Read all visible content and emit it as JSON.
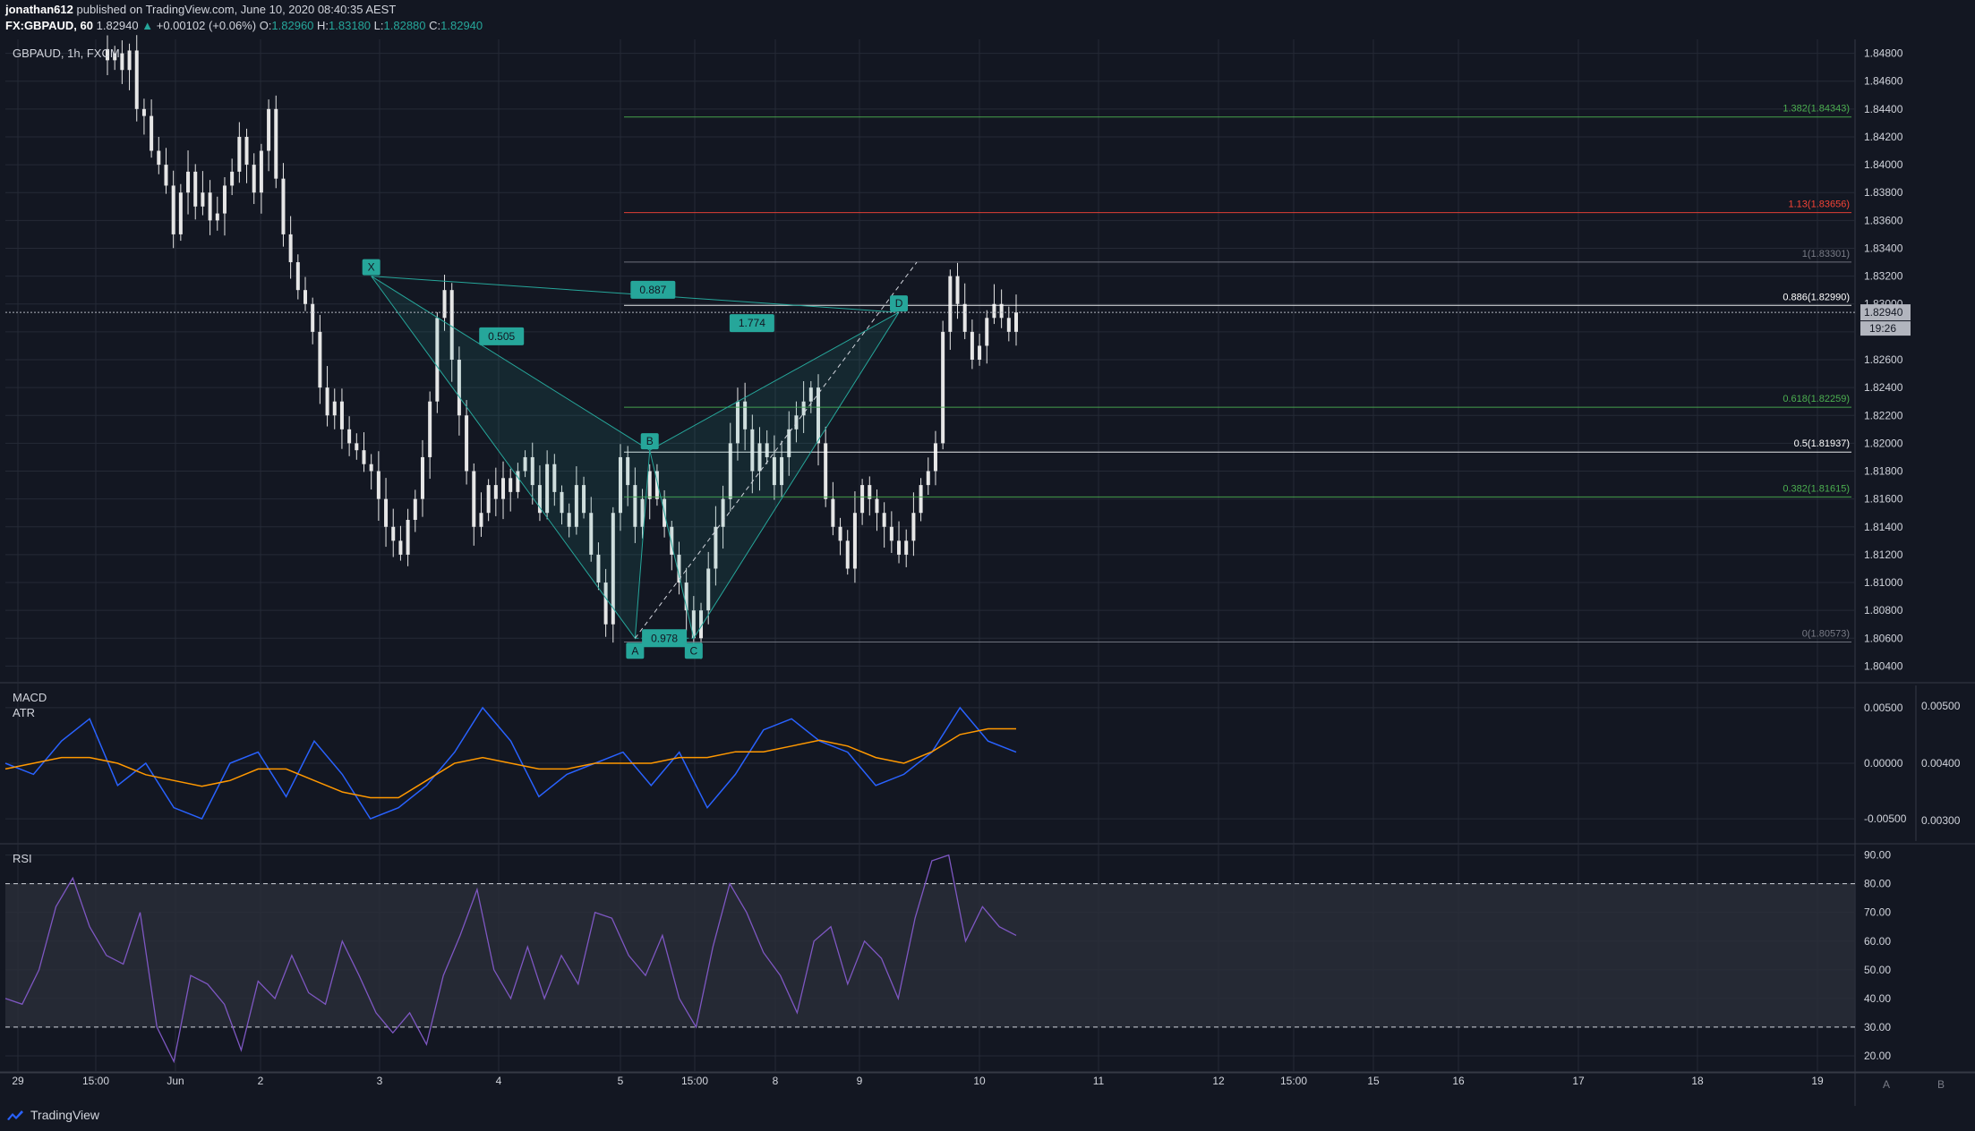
{
  "header": {
    "author": "jonathan612",
    "published": "published on TradingView.com, June 10, 2020 08:40:35 AEST",
    "symbol": "FX:GBPAUD, 60",
    "last": "1.82940",
    "change_arrow": "▲",
    "change": "+0.00102 (+0.06%)",
    "o_label": "O:",
    "o": "1.82960",
    "h_label": "H:",
    "h": "1.83180",
    "l_label": "L:",
    "l": "1.82880",
    "c_label": "C:",
    "c": "1.82940"
  },
  "footer": {
    "brand": "TradingView",
    "logo_icon": "tradingview-logo-icon"
  },
  "colors": {
    "background": "#131722",
    "grid": "#252a36",
    "text": "#d1d4dc",
    "candle": "#e6e6e6",
    "pattern": "#26a69a",
    "macd": "#2962ff",
    "atr": "#ff9800",
    "rsi": "#7e57c2",
    "fib_green": "#4caf50",
    "fib_red": "#f44336",
    "fib_grey": "#787b86",
    "fib_white": "#ffffff"
  },
  "chart_data": [
    {
      "type": "candlestick",
      "title": "GBPAUD, 1h, FXCM",
      "ylim": [
        1.803,
        1.849
      ],
      "y_ticks": [
        "1.84800",
        "1.84600",
        "1.84400",
        "1.84200",
        "1.84000",
        "1.83800",
        "1.83600",
        "1.83400",
        "1.83200",
        "1.83000",
        "1.82800",
        "1.82600",
        "1.82400",
        "1.82200",
        "1.82000",
        "1.81800",
        "1.81600",
        "1.81400",
        "1.81200",
        "1.81000",
        "1.80800",
        "1.80600",
        "1.80400"
      ],
      "x_ticks": [
        "29",
        "15:00",
        "Jun",
        "2",
        "3",
        "4",
        "5",
        "15:00",
        "8",
        "9",
        "10",
        "11",
        "12",
        "15:00",
        "15",
        "16",
        "17",
        "18",
        "19"
      ],
      "current_price": "1.82940",
      "countdown": "19:26",
      "close_series": [
        1.8475,
        1.848,
        1.8468,
        1.8482,
        1.844,
        1.8435,
        1.841,
        1.84,
        1.8385,
        1.835,
        1.838,
        1.8395,
        1.837,
        1.838,
        1.836,
        1.8365,
        1.8385,
        1.8395,
        1.842,
        1.84,
        1.838,
        1.841,
        1.844,
        1.839,
        1.835,
        1.833,
        1.831,
        1.83,
        1.828,
        1.824,
        1.822,
        1.823,
        1.821,
        1.82,
        1.8195,
        1.8185,
        1.818,
        1.816,
        1.814,
        1.813,
        1.812,
        1.8145,
        1.816,
        1.819,
        1.823,
        1.829,
        1.831,
        1.826,
        1.822,
        1.818,
        1.814,
        1.815,
        1.817,
        1.816,
        1.8175,
        1.8165,
        1.818,
        1.819,
        1.817,
        1.815,
        1.8185,
        1.8165,
        1.815,
        1.814,
        1.817,
        1.815,
        1.812,
        1.81,
        1.807,
        1.815,
        1.819,
        1.817,
        1.814,
        1.816,
        1.818,
        1.816,
        1.814,
        1.812,
        1.81,
        1.808,
        1.806,
        1.808,
        1.811,
        1.814,
        1.816,
        1.82,
        1.823,
        1.821,
        1.818,
        1.82,
        1.819,
        1.817,
        1.819,
        1.821,
        1.822,
        1.823,
        1.824,
        1.82,
        1.816,
        1.814,
        1.813,
        1.811,
        1.815,
        1.817,
        1.816,
        1.815,
        1.814,
        1.813,
        1.812,
        1.813,
        1.815,
        1.817,
        1.818,
        1.82,
        1.828,
        1.832,
        1.83,
        1.828,
        1.826,
        1.827,
        1.829,
        1.83,
        1.829,
        1.828,
        1.8294
      ],
      "annotations": {
        "pattern_points": [
          {
            "label": "X",
            "price": 1.832,
            "time_index": 36
          },
          {
            "label": "A",
            "price": 1.806,
            "time_index": 72
          },
          {
            "label": "B",
            "price": 1.8195,
            "time_index": 74
          },
          {
            "label": "C",
            "price": 1.806,
            "time_index": 80
          },
          {
            "label": "D",
            "price": 1.8294,
            "time_index": 108
          }
        ],
        "ratios": [
          {
            "label": "0.505"
          },
          {
            "label": "0.978"
          },
          {
            "label": "1.774"
          },
          {
            "label": "0.887"
          }
        ],
        "fib_levels": [
          {
            "label": "1.382(1.84343)",
            "price": 1.84343,
            "color": "#4caf50"
          },
          {
            "label": "1.13(1.83656)",
            "price": 1.83656,
            "color": "#f44336"
          },
          {
            "label": "1(1.83301)",
            "price": 1.83301,
            "color": "#787b86"
          },
          {
            "label": "0.886(1.82990)",
            "price": 1.8299,
            "color": "#ffffff"
          },
          {
            "label": "0.618(1.82259)",
            "price": 1.82259,
            "color": "#4caf50"
          },
          {
            "label": "0.5(1.81937)",
            "price": 1.81937,
            "color": "#ffffff"
          },
          {
            "label": "0.382(1.81615)",
            "price": 1.81615,
            "color": "#4caf50"
          },
          {
            "label": "0(1.80573)",
            "price": 1.80573,
            "color": "#787b86"
          }
        ]
      }
    },
    {
      "type": "line",
      "title": "MACD",
      "ylim": [
        -0.0062,
        0.0062
      ],
      "y_ticks": [
        "0.00500",
        "0.00000",
        "-0.00500"
      ],
      "series": [
        {
          "name": "MACD",
          "values": [
            0.0,
            -0.001,
            0.002,
            0.004,
            -0.002,
            0.0,
            -0.004,
            -0.005,
            0.0,
            0.001,
            -0.003,
            0.002,
            -0.001,
            -0.005,
            -0.004,
            -0.002,
            0.001,
            0.005,
            0.002,
            -0.003,
            -0.001,
            0.0,
            0.001,
            -0.002,
            0.001,
            -0.004,
            -0.001,
            0.003,
            0.004,
            0.002,
            0.001,
            -0.002,
            -0.001,
            0.001,
            0.005,
            0.002,
            0.001
          ]
        }
      ]
    },
    {
      "type": "line",
      "title": "ATR",
      "ylim": [
        0.0028,
        0.0052
      ],
      "y_ticks": [
        "0.00500",
        "0.00400",
        "0.00300"
      ],
      "series": [
        {
          "name": "ATR",
          "values": [
            0.0039,
            0.004,
            0.0041,
            0.0041,
            0.004,
            0.0038,
            0.0037,
            0.0036,
            0.0037,
            0.0039,
            0.0039,
            0.0037,
            0.0035,
            0.0034,
            0.0034,
            0.0037,
            0.004,
            0.0041,
            0.004,
            0.0039,
            0.0039,
            0.004,
            0.004,
            0.004,
            0.0041,
            0.0041,
            0.0042,
            0.0042,
            0.0043,
            0.0044,
            0.0043,
            0.0041,
            0.004,
            0.0042,
            0.0045,
            0.0046,
            0.0046
          ]
        }
      ]
    },
    {
      "type": "line",
      "title": "RSI",
      "ylim": [
        15,
        93
      ],
      "y_ticks": [
        "90.00",
        "80.00",
        "70.00",
        "60.00",
        "50.00",
        "40.00",
        "30.00",
        "20.00"
      ],
      "bands": [
        30,
        70,
        80
      ],
      "series": [
        {
          "name": "RSI",
          "values": [
            40,
            38,
            50,
            72,
            82,
            65,
            55,
            52,
            70,
            30,
            18,
            48,
            45,
            38,
            22,
            46,
            40,
            55,
            42,
            38,
            60,
            48,
            35,
            28,
            35,
            24,
            48,
            62,
            78,
            50,
            40,
            58,
            40,
            55,
            45,
            70,
            68,
            55,
            48,
            62,
            40,
            30,
            58,
            80,
            70,
            56,
            48,
            35,
            60,
            65,
            45,
            60,
            54,
            40,
            68,
            88,
            90,
            60,
            72,
            65,
            62
          ]
        }
      ]
    }
  ],
  "panes_right": {
    "a_label": "A",
    "b_label": "B"
  }
}
